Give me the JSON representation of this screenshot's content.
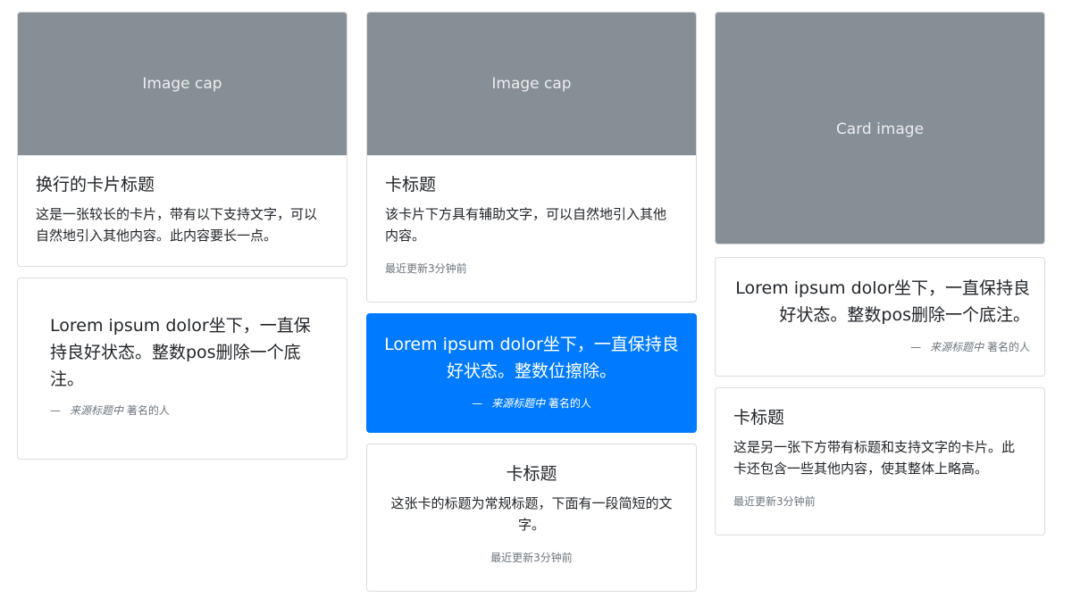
{
  "col1": {
    "card1": {
      "image_label": "Image cap",
      "title": "换行的卡片标题",
      "text": "这是一张较长的卡片，带有以下支持文字，可以自然地引入其他内容。此内容要长一点。"
    },
    "quote1": {
      "text": "Lorem ipsum dolor坐下，一直保持良好状态。整数pos删除一个底注。",
      "dash": "—",
      "cite": "来源标题中",
      "author": "著名的人"
    }
  },
  "col2": {
    "card1": {
      "image_label": "Image cap",
      "title": "卡标题",
      "text": "该卡片下方具有辅助文字，可以自然地引入其他内容。",
      "updated": "最近更新3分钟前"
    },
    "quote_primary": {
      "text": "Lorem ipsum dolor坐下，一直保持良好状态。整数位擦除。",
      "dash": "—",
      "cite": "来源标题中",
      "author": "著名的人"
    },
    "card2": {
      "title": "卡标题",
      "text": "这张卡的标题为常规标题，下面有一段简短的文字。",
      "updated": "最近更新3分钟前"
    }
  },
  "col3": {
    "card_image": {
      "image_label": "Card image"
    },
    "quote_right": {
      "text": "Lorem ipsum dolor坐下，一直保持良好状态。整数pos删除一个底注。",
      "dash": "—",
      "cite": "来源标题中",
      "author": "著名的人"
    },
    "card2": {
      "title": "卡标题",
      "text": "这是另一张下方带有标题和支持文字的卡片。此卡还包含一些其他内容，使其整体上略高。",
      "updated": "最近更新3分钟前"
    }
  },
  "colors": {
    "image_placeholder": "#868e96",
    "primary": "#007bff",
    "muted": "#6c757d",
    "border": "#dcdcdc"
  }
}
